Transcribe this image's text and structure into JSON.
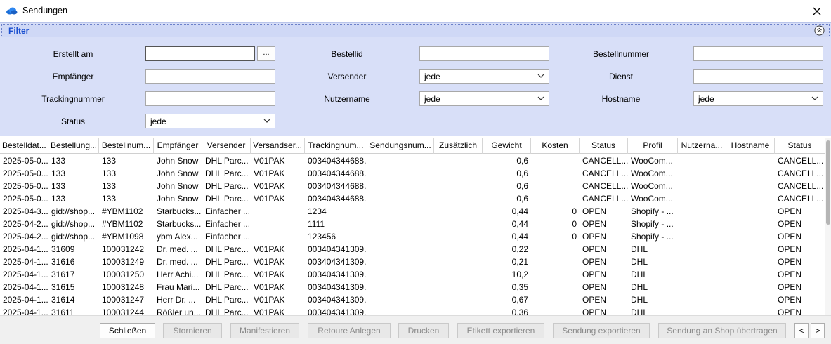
{
  "window": {
    "title": "Sendungen"
  },
  "filter": {
    "title": "Filter",
    "labels": {
      "erstellt_am": "Erstellt am",
      "bestellid": "Bestellid",
      "bestellnummer": "Bestellnummer",
      "empfaenger": "Empfänger",
      "versender": "Versender",
      "dienst": "Dienst",
      "trackingnummer": "Trackingnummer",
      "nutzername": "Nutzername",
      "hostname": "Hostname",
      "status": "Status"
    },
    "values": {
      "erstellt_am": "",
      "bestellid": "",
      "bestellnummer": "",
      "empfaenger": "",
      "dienst": "",
      "trackingnummer": "",
      "versender": "jede",
      "nutzername": "jede",
      "hostname": "jede",
      "status": "jede"
    },
    "dots_label": "..."
  },
  "grid": {
    "columns": [
      "Bestelldat...",
      "Bestellung...",
      "Bestellnum...",
      "Empfänger",
      "Versender",
      "Versandser...",
      "Trackingnum...",
      "Sendungsnum...",
      "Zusätzlich",
      "Gewicht",
      "Kosten",
      "Status",
      "Profil",
      "Nutzerna...",
      "Hostname",
      "Status"
    ],
    "rows": [
      [
        "2025-05-0...",
        "133",
        "133",
        "John Snow",
        "DHL Parc...",
        "V01PAK",
        "003404344688...",
        "",
        "",
        "0,6",
        "",
        "CANCELL...",
        "WooCom...",
        "",
        "",
        "CANCELL..."
      ],
      [
        "2025-05-0...",
        "133",
        "133",
        "John Snow",
        "DHL Parc...",
        "V01PAK",
        "003404344688...",
        "",
        "",
        "0,6",
        "",
        "CANCELL...",
        "WooCom...",
        "",
        "",
        "CANCELL..."
      ],
      [
        "2025-05-0...",
        "133",
        "133",
        "John Snow",
        "DHL Parc...",
        "V01PAK",
        "003404344688...",
        "",
        "",
        "0,6",
        "",
        "CANCELL...",
        "WooCom...",
        "",
        "",
        "CANCELL..."
      ],
      [
        "2025-05-0...",
        "133",
        "133",
        "John Snow",
        "DHL Parc...",
        "V01PAK",
        "003404344688...",
        "",
        "",
        "0,6",
        "",
        "CANCELL...",
        "WooCom...",
        "",
        "",
        "CANCELL..."
      ],
      [
        "2025-04-3...",
        "gid://shop...",
        "#YBM1102",
        "Starbucks...",
        "Einfacher ...",
        "",
        "1234",
        "",
        "",
        "0,44",
        "0",
        "OPEN",
        "Shopify - ...",
        "",
        "",
        "OPEN"
      ],
      [
        "2025-04-2...",
        "gid://shop...",
        "#YBM1102",
        "Starbucks...",
        "Einfacher ...",
        "",
        "1111",
        "",
        "",
        "0,44",
        "0",
        "OPEN",
        "Shopify - ...",
        "",
        "",
        "OPEN"
      ],
      [
        "2025-04-2...",
        "gid://shop...",
        "#YBM1098",
        "ybm Alex...",
        "Einfacher ...",
        "",
        "123456",
        "",
        "",
        "0,44",
        "0",
        "OPEN",
        "Shopify - ...",
        "",
        "",
        "OPEN"
      ],
      [
        "2025-04-1...",
        "31609",
        "100031242",
        "Dr. med. ...",
        "DHL Parc...",
        "V01PAK",
        "003404341309...",
        "",
        "",
        "0,22",
        "",
        "OPEN",
        "DHL",
        "",
        "",
        "OPEN"
      ],
      [
        "2025-04-1...",
        "31616",
        "100031249",
        "Dr. med. ...",
        "DHL Parc...",
        "V01PAK",
        "003404341309...",
        "",
        "",
        "0,21",
        "",
        "OPEN",
        "DHL",
        "",
        "",
        "OPEN"
      ],
      [
        "2025-04-1...",
        "31617",
        "100031250",
        "Herr Achi...",
        "DHL Parc...",
        "V01PAK",
        "003404341309...",
        "",
        "",
        "10,2",
        "",
        "OPEN",
        "DHL",
        "",
        "",
        "OPEN"
      ],
      [
        "2025-04-1...",
        "31615",
        "100031248",
        "Frau Mari...",
        "DHL Parc...",
        "V01PAK",
        "003404341309...",
        "",
        "",
        "0,35",
        "",
        "OPEN",
        "DHL",
        "",
        "",
        "OPEN"
      ],
      [
        "2025-04-1...",
        "31614",
        "100031247",
        "Herr Dr. ...",
        "DHL Parc...",
        "V01PAK",
        "003404341309...",
        "",
        "",
        "0,67",
        "",
        "OPEN",
        "DHL",
        "",
        "",
        "OPEN"
      ],
      [
        "2025-04-1...",
        "31611",
        "100031244",
        "Rößler un...",
        "DHL Parc...",
        "V01PAK",
        "003404341309...",
        "",
        "",
        "0,36",
        "",
        "OPEN",
        "DHL",
        "",
        "",
        "OPEN"
      ]
    ]
  },
  "footer": {
    "buttons": [
      "Schließen",
      "Stornieren",
      "Manifestieren",
      "Retoure Anlegen",
      "Drucken",
      "Etikett exportieren",
      "Sendung exportieren",
      "Sendung an Shop übertragen"
    ],
    "prev": "<",
    "next": ">"
  }
}
